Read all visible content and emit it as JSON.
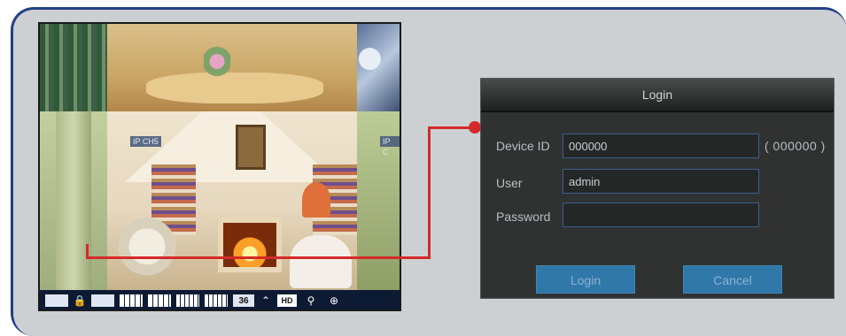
{
  "camera": {
    "ch5_label": "IP CH5",
    "ch6_label": "IP C"
  },
  "toolbar": {
    "layout_36": "36",
    "hd": "HD"
  },
  "dialog": {
    "title": "Login",
    "device_id_label": "Device ID",
    "device_id_value": "000000",
    "device_id_hint": "( 000000 )",
    "user_label": "User",
    "user_value": "admin",
    "password_label": "Password",
    "password_value": "",
    "login_button": "Login",
    "cancel_button": "Cancel"
  },
  "colors": {
    "frame_border": "#233f86",
    "connector": "#d42a2a",
    "button": "#2f78a8"
  }
}
